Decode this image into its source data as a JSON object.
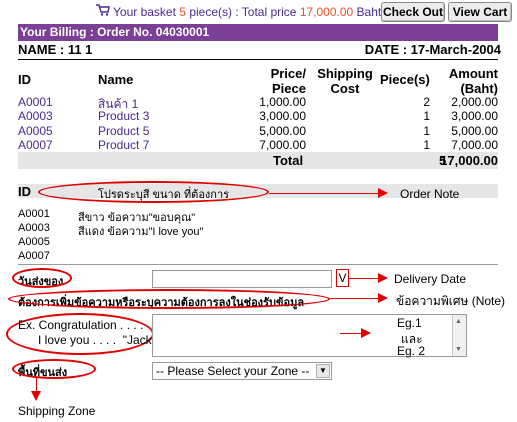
{
  "header": {
    "basket_prefix": "Your basket",
    "basket_count": "5",
    "basket_mid": "piece(s) : Total price",
    "basket_total": "17,000.00",
    "basket_currency": "Baht",
    "checkout_label": "Check Out",
    "viewcart_label": "View Cart"
  },
  "billing": {
    "title": "Your Billing : Order No. 04030001",
    "name": "NAME : 11 1",
    "date": "DATE : 17-March-2004"
  },
  "table": {
    "headers": {
      "id": "ID",
      "name": "Name",
      "price_line1": "Price/",
      "price_line2": "Piece",
      "ship_line1": "Shipping",
      "ship_line2": "Cost",
      "pieces": "Piece(s)",
      "amount_line1": "Amount",
      "amount_line2": "(Baht)"
    },
    "rows": [
      {
        "id": "A0001",
        "name": "สินค้า 1",
        "price": "1,000.00",
        "pieces": "2",
        "amount": "2,000.00"
      },
      {
        "id": "A0003",
        "name": "Product 3",
        "price": "3,000.00",
        "pieces": "1",
        "amount": "3,000.00"
      },
      {
        "id": "A0005",
        "name": "Product 5",
        "price": "5,000.00",
        "pieces": "1",
        "amount": "5,000.00"
      },
      {
        "id": "A0007",
        "name": "Product 7",
        "price": "7,000.00",
        "pieces": "1",
        "amount": "7,000.00"
      }
    ],
    "total_label": "Total",
    "total_pieces": "5",
    "total_amount": "17,000.00"
  },
  "notes": {
    "id_header": "ID",
    "hint": "โปรดระบุสี ขนาด ที่ต้องการ",
    "rows": [
      {
        "id": "A0001",
        "text": "สีขาว ข้อความ\"ขอบคุณ\""
      },
      {
        "id": "A0003",
        "text": "สีแดง ข้อความ\"I love you\""
      },
      {
        "id": "A0005",
        "text": ""
      },
      {
        "id": "A0007",
        "text": ""
      }
    ]
  },
  "form": {
    "delivery_label": "วันส่งของ",
    "calendar_button": "V",
    "message_label": "ต้องการเพิ่มข้อความหรือระบุความต้องการลงในช่องรับข้อมูล",
    "example_line1": "Ex. Congratulation . . . .",
    "example_line2": "I love you . . . .  \"Jack\"",
    "zone_label": "พื้นที่ขนส่ง",
    "zone_select": "-- Please Select your Zone --"
  },
  "annotations": {
    "order_note": "Order Note",
    "delivery_date": "Delivery Date",
    "special_note": "ข้อความพิเศษ (Note)",
    "eg1": "Eg.1",
    "and": "และ",
    "eg2": "Eg. 2",
    "shipping_zone": "Shipping Zone"
  }
}
